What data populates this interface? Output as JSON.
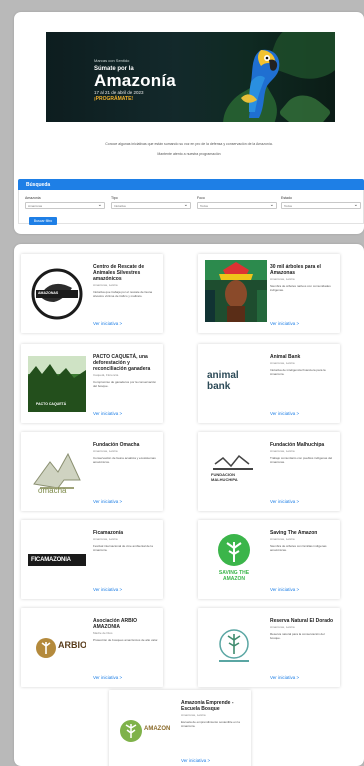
{
  "banner": {
    "pre": "Marcas con Sentido",
    "subtitle": "Súmate por la",
    "title": "Amazonía",
    "date": "17 al 21 de abril de 2023",
    "cta": "¡PROGRÁMATE!"
  },
  "intro": {
    "line1": "Conoce algunas iniciativas que están sumando su voz en pro de la defensa y conservación de la Amazonía.",
    "line2": "Mantente atento a nuestra programación"
  },
  "search": {
    "heading": "Búsqueda",
    "filters": [
      {
        "label": "Amazonia",
        "value": "Amazonas"
      },
      {
        "label": "Tipo",
        "value": "Iniciativa"
      },
      {
        "label": "Foco",
        "value": "Todos"
      },
      {
        "label": "Estado",
        "value": "Todos"
      }
    ],
    "button": "Buscar filtro"
  },
  "cards": [
    {
      "title": "Centro de Rescate de Animales Silvestres amazónicos",
      "meta": "Amazonas, Leticia",
      "desc": "Iniciativa que trabaja por el rescate de fauna silvestre víctima de tráfico y maltrato.",
      "link": "Ver iniciativa >",
      "logo_text": "AMAZONAS"
    },
    {
      "title": "30 mil árboles para el Amazonas",
      "meta": "Amazonas, Leticia",
      "desc": "Siembra de árboles nativos con comunidades indígenas.",
      "link": "Ver iniciativa >",
      "logo_text": ""
    },
    {
      "title": "PACTO CAQUETÁ, una deforestación y reconciliación ganadera",
      "meta": "Caquetá, Florencia",
      "desc": "Compromiso de ganaderos por la conservación del bosque.",
      "link": "Ver iniciativa >",
      "logo_text": "PACTO CAQUETÁ"
    },
    {
      "title": "Animal Bank",
      "meta": "Amazonas, Leticia",
      "desc": "Iniciativa de inteligencia financiera para la Amazonía.",
      "link": "Ver iniciativa >",
      "logo_text": "animal bank"
    },
    {
      "title": "Fundación Omacha",
      "meta": "Amazonas, Leticia",
      "desc": "Conservación de fauna acuática y ecosistemas amazónicos.",
      "link": "Ver iniciativa >",
      "logo_text": "omacha"
    },
    {
      "title": "Fundación Malhuchipa",
      "meta": "Amazonas, Leticia",
      "desc": "Trabajo comunitario con pueblos indígenas del Amazonas.",
      "link": "Ver iniciativa >",
      "logo_text": "FUNDACION MALHUCHIPA"
    },
    {
      "title": "Ficamazonía",
      "meta": "Amazonas, Leticia",
      "desc": "Festival internacional de cine ambiental de la Amazonía.",
      "link": "Ver iniciativa >",
      "logo_text": "FICAMAZONIA"
    },
    {
      "title": "Saving The Amazon",
      "meta": "Amazonas, Leticia",
      "desc": "Siembra de árboles con familias indígenas amazónicas.",
      "link": "Ver iniciativa >",
      "logo_text": "SAVING THE AMAZON"
    },
    {
      "title": "Asociación ARBIO AMAZONIA",
      "meta": "Madre de Dios",
      "desc": "Protección de bosques amazónicos de alto valor.",
      "link": "Ver iniciativa >",
      "logo_text": "ARBIO"
    },
    {
      "title": "Reserva Natural El Dorado",
      "meta": "Amazonas, Leticia",
      "desc": "Reserva natural para la conservación del bosque.",
      "link": "Ver iniciativa >",
      "logo_text": ""
    },
    {
      "title": "Amazonía Emprende - Escuela Bosque",
      "meta": "Amazonas, Leticia",
      "desc": "Escuela de emprendimiento sostenible en la Amazonía.",
      "link": "Ver iniciativa >",
      "logo_text": "AMAZON"
    }
  ]
}
